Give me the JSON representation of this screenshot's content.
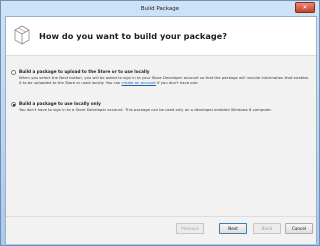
{
  "window": {
    "title": "Build Package",
    "close_glyph": "✕"
  },
  "header": {
    "heading": "How do you want to build your package?",
    "icon": "package-icon"
  },
  "options": [
    {
      "label": "Build a package to upload to the Store or to use locally",
      "desc_before_link": "When you select the Next button, you will be asked to sign in to your Store Developer account so that the package will include information that enables it to be uploaded to the Store or used locally. You can ",
      "link_text": "create an account",
      "desc_after_link": " if you don't have one.",
      "selected": false
    },
    {
      "label": "Build a package to use locally only",
      "desc": "You don't have to sign in to a Store Developer account. This package can be used only on a developer-enabled Windows 8 computer.",
      "selected": true
    }
  ],
  "footer": {
    "previous": "Previous",
    "next": "Next",
    "build": "Build",
    "cancel": "Cancel"
  }
}
